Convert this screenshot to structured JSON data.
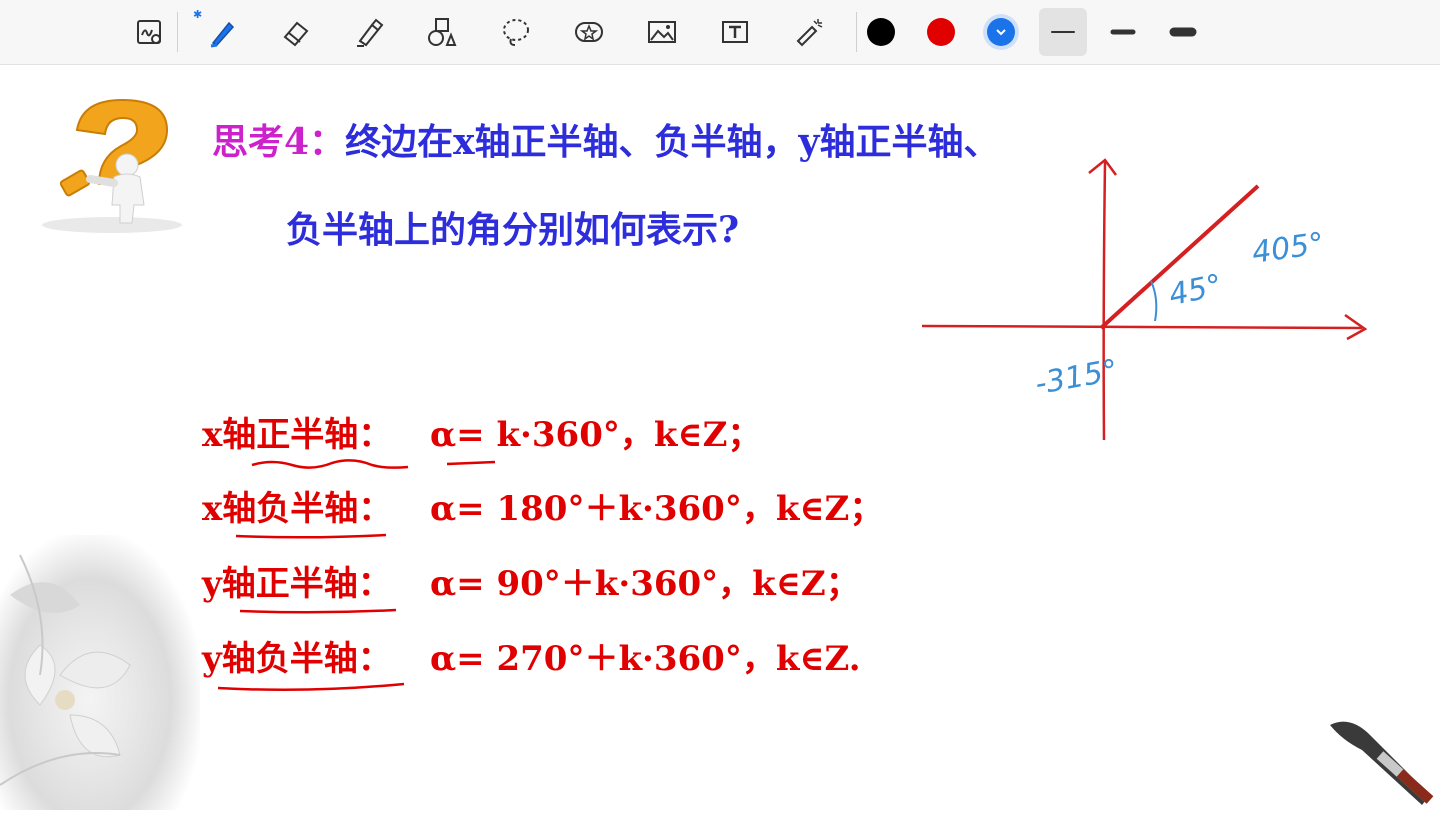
{
  "toolbar": {
    "tools": [
      "handwriting-recognition-icon",
      "pen-icon",
      "eraser-icon",
      "highlighter-icon",
      "shapes-icon",
      "lasso-icon",
      "sticker-icon",
      "image-icon",
      "text-box-icon",
      "laser-pointer-icon"
    ],
    "colors": [
      "#000000",
      "#e00000",
      "#1a73e8"
    ],
    "selected_color": "#1a73e8",
    "stroke_widths": [
      "thin",
      "medium",
      "thick"
    ],
    "selected_stroke": "thin"
  },
  "slide": {
    "title_prefix": "思考4：",
    "title_rest": "终边在x轴正半轴、负半轴，y轴正半轴、",
    "title_line2": "负半轴上的角分别如何表示?",
    "formulas": [
      {
        "label": "x轴正半轴：",
        "expr": "α= k·360°，k∈Z；"
      },
      {
        "label": "x轴负半轴：",
        "expr": "α= 180°＋k·360°，k∈Z；"
      },
      {
        "label": "y轴正半轴：",
        "expr": "α= 90°＋k·360°，k∈Z；"
      },
      {
        "label": "y轴负半轴：",
        "expr": "α= 270°＋k·360°，k∈Z."
      }
    ],
    "annotations": {
      "angle_small": "45°",
      "angle_large": "405°",
      "angle_negative": "-315°"
    }
  },
  "colors": {
    "title_purple": "#cc22cc",
    "title_blue": "#2d2ddc",
    "formula_red": "#e00000",
    "ink_blue": "#3a8fd6",
    "axis_red": "#d42020"
  }
}
